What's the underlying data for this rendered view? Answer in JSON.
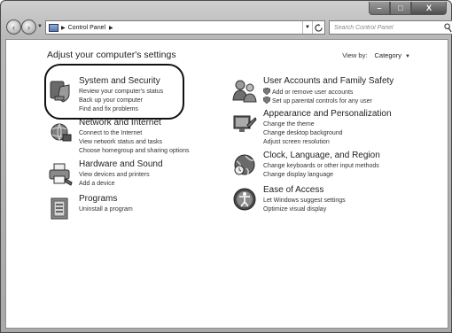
{
  "window": {
    "caption": {
      "minimize": "–",
      "maximize": "□",
      "close": "X"
    }
  },
  "nav": {
    "back": "‹",
    "forward": "›",
    "address_segment": "Control Panel",
    "refresh": "⁴⁺",
    "search_placeholder": "Search Control Panel"
  },
  "main": {
    "heading": "Adjust your computer's settings",
    "view_by_label": "View by:",
    "view_by_value": "Category"
  },
  "categories": [
    {
      "title": "System and Security",
      "links": [
        "Review your computer's status",
        "Back up your computer",
        "Find and fix problems"
      ]
    },
    {
      "title": "Network and Internet",
      "links": [
        "Connect to the Internet",
        "View network status and tasks",
        "Choose homegroup and sharing options"
      ]
    },
    {
      "title": "Hardware and Sound",
      "links": [
        "View devices and printers",
        "Add a device"
      ]
    },
    {
      "title": "Programs",
      "links": [
        "Uninstall a program"
      ]
    },
    {
      "title": "User Accounts and Family Safety",
      "links": [
        "Add or remove user accounts",
        "Set up parental controls for any user"
      ]
    },
    {
      "title": "Appearance and Personalization",
      "links": [
        "Change the theme",
        "Change desktop background",
        "Adjust screen resolution"
      ]
    },
    {
      "title": "Clock, Language, and Region",
      "links": [
        "Change keyboards or other input methods",
        "Change display language"
      ]
    },
    {
      "title": "Ease of Access",
      "links": [
        "Let Windows suggest settings",
        "Optimize visual display"
      ]
    }
  ]
}
